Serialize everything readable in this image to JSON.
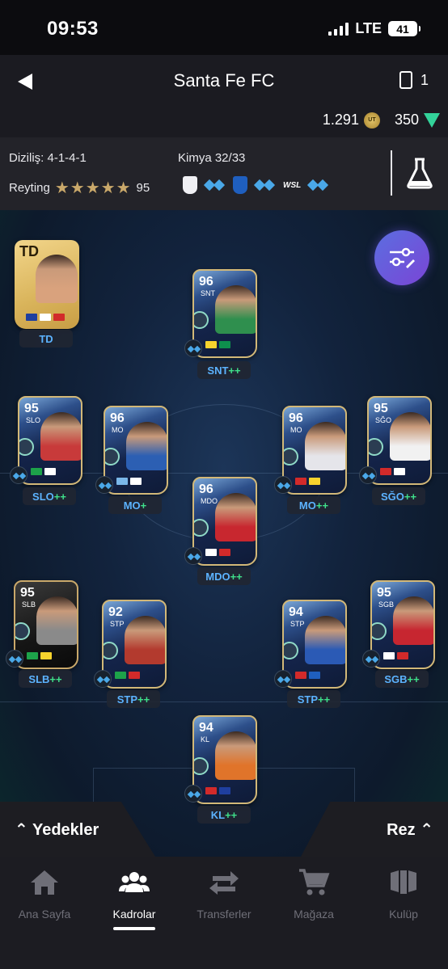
{
  "status_bar": {
    "time": "09:53",
    "network": "LTE",
    "battery": "41"
  },
  "header": {
    "title": "Santa Fe FC",
    "squad_count": "1",
    "coins": "1.291",
    "points": "350",
    "coin_icon_text": "UT"
  },
  "info": {
    "formation": "Diziliş: 4-1-4-1",
    "chemistry": "Kimya 32/33",
    "rating_label": "Reyting",
    "stars": "★★★★★",
    "rating_value": "95",
    "wsl_badge": "WSL"
  },
  "players": [
    {
      "id": "td",
      "rating": "TD",
      "position": "",
      "label": "TD",
      "plus": "",
      "flags": [
        "#1f3f9f",
        "#ffffff",
        "#d22a2a"
      ]
    },
    {
      "id": "snt",
      "rating": "96",
      "position": "SNT",
      "label": "SNT",
      "plus": "++",
      "flags": [
        "#f7d32d",
        "#0e8f4d"
      ]
    },
    {
      "id": "slo",
      "rating": "95",
      "position": "SLO",
      "label": "SLO",
      "plus": "++",
      "flags": [
        "#1da34a",
        "#ffffff"
      ]
    },
    {
      "id": "mo1",
      "rating": "96",
      "position": "MO",
      "label": "MO",
      "plus": "+",
      "flags": [
        "#7ab7e8",
        "#ffffff"
      ]
    },
    {
      "id": "mo2",
      "rating": "96",
      "position": "MO",
      "label": "MO",
      "plus": "++",
      "flags": [
        "#d22a2a",
        "#f7d32d"
      ]
    },
    {
      "id": "sgo",
      "rating": "95",
      "position": "SĞO",
      "label": "SĞO",
      "plus": "++",
      "flags": [
        "#d22a2a",
        "#ffffff"
      ]
    },
    {
      "id": "mdo",
      "rating": "96",
      "position": "MDO",
      "label": "MDO",
      "plus": "++",
      "flags": [
        "#ffffff",
        "#d22a2a"
      ]
    },
    {
      "id": "slb",
      "rating": "95",
      "position": "SLB",
      "label": "SLB",
      "plus": "++",
      "flags": [
        "#1da34a",
        "#f7d32d"
      ]
    },
    {
      "id": "stp1",
      "rating": "92",
      "position": "STP",
      "label": "STP",
      "plus": "++",
      "flags": [
        "#1da34a",
        "#d22a2a"
      ]
    },
    {
      "id": "stp2",
      "rating": "94",
      "position": "STP",
      "label": "STP",
      "plus": "++",
      "flags": [
        "#d22a2a",
        "#1f5fbf"
      ]
    },
    {
      "id": "sgb",
      "rating": "95",
      "position": "SGB",
      "label": "SGB",
      "plus": "++",
      "flags": [
        "#ffffff",
        "#d22a2a"
      ]
    },
    {
      "id": "kl",
      "rating": "94",
      "position": "KL",
      "label": "KL",
      "plus": "++",
      "flags": [
        "#d22a2a",
        "#1f3f9f"
      ]
    }
  ],
  "bench": {
    "left": "Yedekler",
    "right": "Rez"
  },
  "tabs": [
    {
      "label": "Ana Sayfa",
      "icon": "home-icon"
    },
    {
      "label": "Kadrolar",
      "icon": "squad-icon"
    },
    {
      "label": "Transferler",
      "icon": "transfer-icon"
    },
    {
      "label": "Mağaza",
      "icon": "cart-icon"
    },
    {
      "label": "Kulüp",
      "icon": "club-icon"
    }
  ]
}
